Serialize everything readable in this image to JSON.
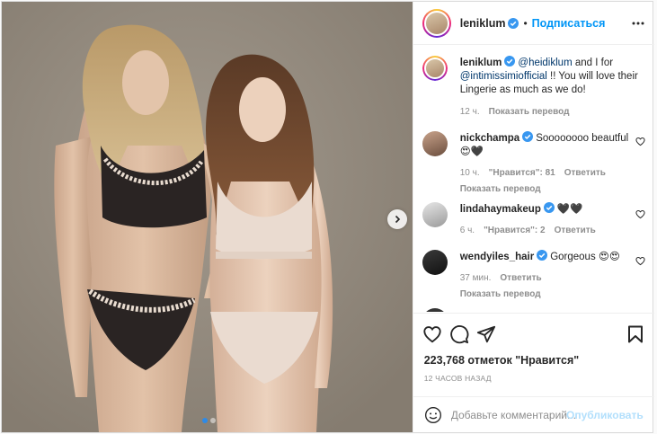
{
  "colors": {
    "accent": "#0095f6",
    "verified": "#3897f0",
    "muted": "#8e8e8e",
    "publish_disabled": "#b2dffc"
  },
  "header": {
    "username": "leniklum",
    "separator": "•",
    "follow_label": "Подписаться"
  },
  "caption": {
    "username": "leniklum",
    "mention_1": "@heidiklum",
    "text_1": " and I for ",
    "mention_2": "@intimissimiofficial",
    "text_2": " !! You will love their Lingerie as much as we do!",
    "time": "12 ч.",
    "translate_label": "Показать перевод"
  },
  "comments": [
    {
      "username": "nickchampa",
      "text": "Soooooooo beautful 😍🖤",
      "time": "10 ч.",
      "likes": "\"Нравится\": 81",
      "reply_label": "Ответить",
      "translate_label": "Показать перевод"
    },
    {
      "username": "lindahaymakeup",
      "text": "🖤🖤",
      "time": "6 ч.",
      "likes": "\"Нравится\": 2",
      "reply_label": "Ответить"
    },
    {
      "username": "wendyiles_hair",
      "text": "Gorgeous 😍😍",
      "time": "37 мин.",
      "reply_label": "Ответить",
      "translate_label": "Показать перевод"
    }
  ],
  "actions": {
    "icons": [
      "heart-icon",
      "comment-icon",
      "share-icon",
      "bookmark-icon"
    ],
    "likes_text": "223,768 отметок \"Нравится\"",
    "timestamp": "12 ЧАСОВ НАЗАД"
  },
  "add_comment": {
    "placeholder": "Добавьте комментарий...",
    "publish_label": "Опубликовать"
  },
  "carousel": {
    "total_slides": 2,
    "current_slide": 1
  }
}
